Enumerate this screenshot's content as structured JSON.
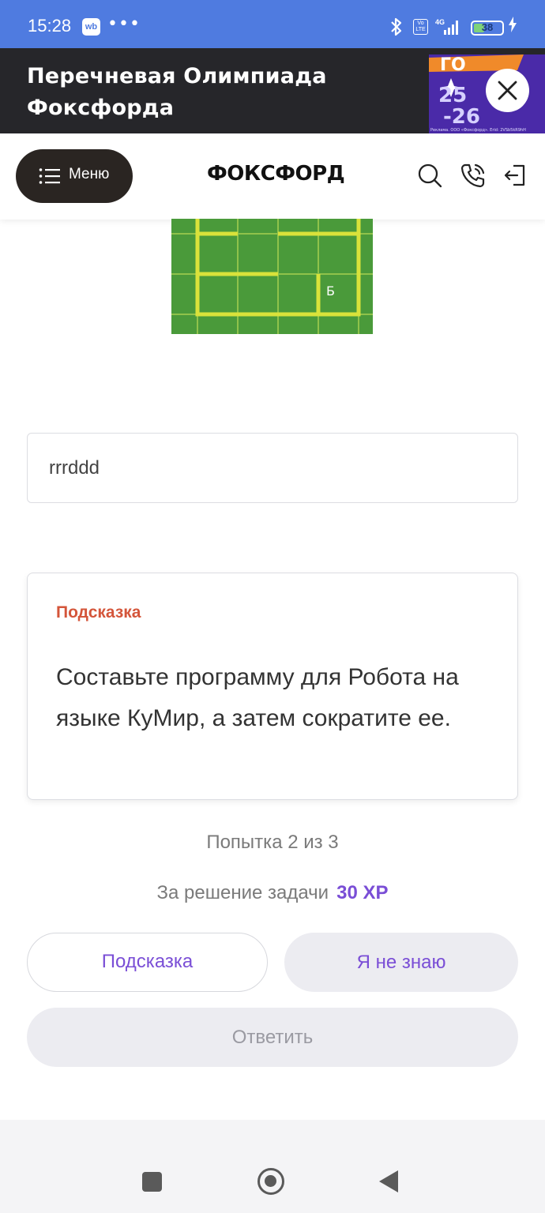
{
  "status_bar": {
    "time": "15:28",
    "app_badge": "wb",
    "more": "•••",
    "network": "4G",
    "volte": "Vo LTE",
    "battery": "38",
    "battery_level": 0.38
  },
  "promo": {
    "title": "Перечневая Олимпиада Фоксфорда",
    "art_text_1": "ГО",
    "art_text_2": "25",
    "art_text_3": "-26",
    "art_footer": "Реклама. ООО «Фоксфорд». Erid: 2VSb5kR9hH"
  },
  "header": {
    "menu_label": "Меню",
    "brand": "ФОКСФОРД"
  },
  "field": {
    "cell_label": "Б"
  },
  "answer": {
    "value": "rrrddd"
  },
  "hint": {
    "title": "Подсказка",
    "text": "Составьте программу для Робота на языке КуМир, а затем сократите ее."
  },
  "attempt_text": "Попытка 2 из 3",
  "reward": {
    "label": "За решение задачи",
    "value": "30 XP"
  },
  "buttons": {
    "hint": "Подсказка",
    "dont_know": "Я не знаю",
    "answer": "Ответить"
  },
  "colors": {
    "status_bar": "#4f7be0",
    "promo_bg": "#26262a",
    "accent_purple": "#7a4ed6",
    "hint_title": "#d4553a",
    "field_green": "#4a9a3a",
    "field_wall": "#d9e23a"
  }
}
